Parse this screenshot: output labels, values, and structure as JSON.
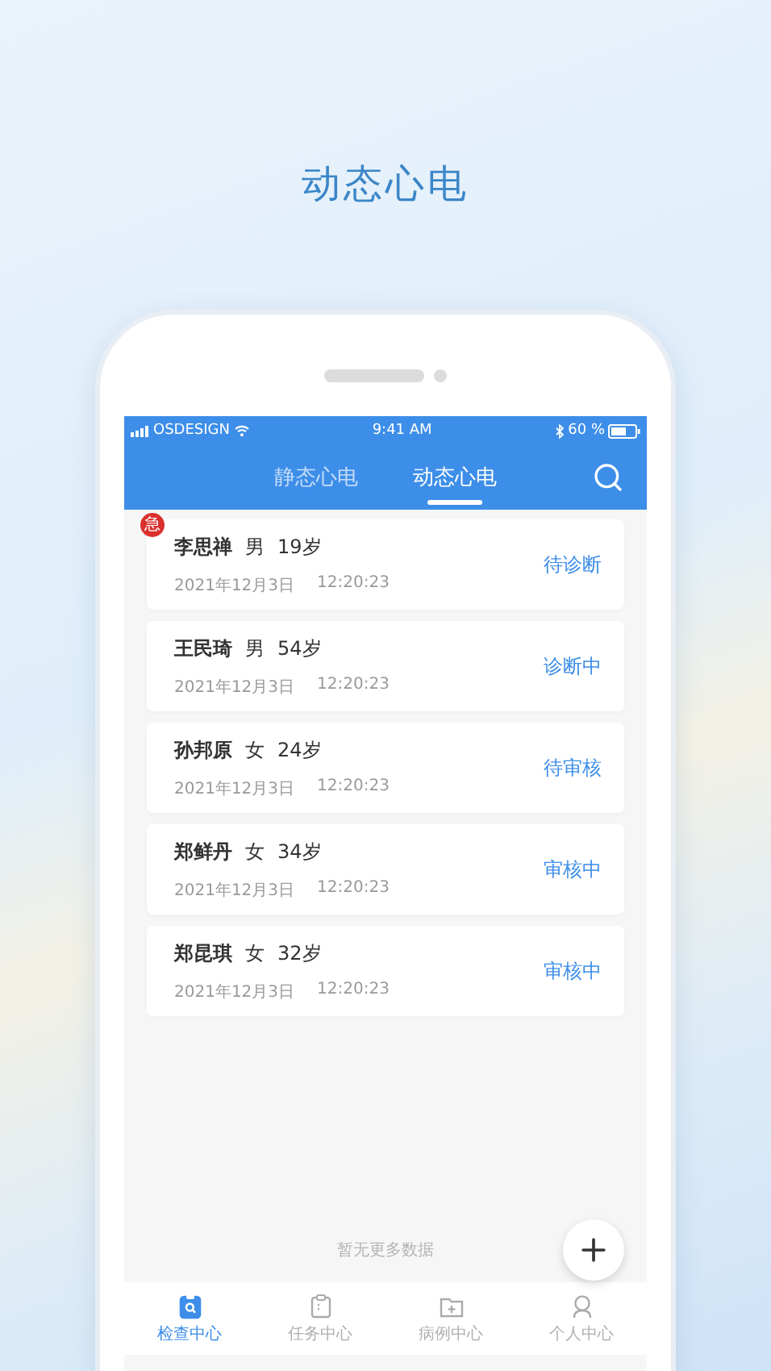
{
  "title": "动态心电",
  "status_bar": {
    "carrier": "OSDESIGN",
    "time": "9:41 AM",
    "battery": "60 %"
  },
  "tabs": [
    {
      "label": "静态心电",
      "selected": false
    },
    {
      "label": "动态心电",
      "selected": true
    }
  ],
  "records": [
    {
      "badge": "急",
      "name": "李思禅",
      "gender": "男",
      "age": "19岁",
      "date": "2021年12月3日",
      "time": "12:20:23",
      "status": "待诊断"
    },
    {
      "name": "王民琦",
      "gender": "男",
      "age": "54岁",
      "date": "2021年12月3日",
      "time": "12:20:23",
      "status": "诊断中"
    },
    {
      "name": "孙邦原",
      "gender": "女",
      "age": "24岁",
      "date": "2021年12月3日",
      "time": "12:20:23",
      "status": "待审核"
    },
    {
      "name": "郑鲜丹",
      "gender": "女",
      "age": "34岁",
      "date": "2021年12月3日",
      "time": "12:20:23",
      "status": "审核中"
    },
    {
      "name": "郑昆琪",
      "gender": "女",
      "age": "32岁",
      "date": "2021年12月3日",
      "time": "12:20:23",
      "status": "审核中"
    }
  ],
  "footer_text": "暂无更多数据",
  "nav": [
    {
      "label": "检查中心",
      "selected": true,
      "kind": "exam"
    },
    {
      "label": "任务中心",
      "selected": false,
      "kind": "task"
    },
    {
      "label": "病例中心",
      "selected": false,
      "kind": "case"
    },
    {
      "label": "个人中心",
      "selected": false,
      "kind": "profile"
    }
  ]
}
